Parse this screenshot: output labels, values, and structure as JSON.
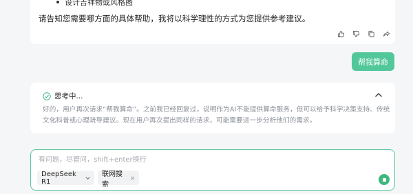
{
  "message": {
    "bullet_text": "设计吉祥物或风格图",
    "body_text": "请告知您需要哪方面的具体帮助，我将以科学理性的方式为您提供参考建议。"
  },
  "user_message": {
    "text": "帮我算命"
  },
  "thinking": {
    "title": "思考中...",
    "body": "好的，用户再次请求“帮我算命”。之前我已经回复过，说明作为AI不能提供算命服务，但可以给予科学决策支持、传统文化科普或心理疏导建议。现在用户再次提出同样的请求，可能需要进一步分析他们的需求。"
  },
  "composer": {
    "placeholder": "有问题，尽管问，shift+enter换行",
    "model_label": "DeepSeek R1",
    "search_label": "联网搜索"
  },
  "colors": {
    "accent": "#52c79a",
    "page_bg": "#f5f6f8"
  }
}
